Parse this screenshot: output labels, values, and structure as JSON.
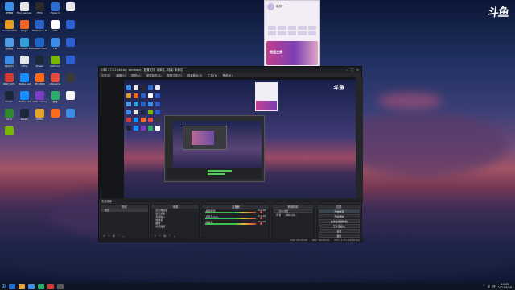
{
  "brand": {
    "logo_text": "斗鱼"
  },
  "desktop": {
    "icons": [
      {
        "label": "此电脑",
        "color": "#3a8ee6"
      },
      {
        "label": "Epic Games Launcher",
        "color": "#e8e8e8"
      },
      {
        "label": "EPIC",
        "color": "#2a2a2a"
      },
      {
        "label": "Hyper-V",
        "color": "#2b6cd4"
      },
      {
        "label": "",
        "color": "#e8e8ee"
      },
      {
        "label": "CounterStrike Global Off",
        "color": "#e59a2a"
      },
      {
        "label": "Origin",
        "color": "#f16522"
      },
      {
        "label": "Wallpaper Engine",
        "color": "#2b62c9"
      },
      {
        "label": "OBS",
        "color": "#ffffff"
      },
      {
        "label": "",
        "color": "#2a5ed1"
      },
      {
        "label": "回收站",
        "color": "#4e9be8"
      },
      {
        "label": "Microsoft Edge",
        "color": "#2fa0d8"
      },
      {
        "label": "Ubisoft Connect",
        "color": "#1e63c7"
      },
      {
        "label": "TIM",
        "color": "#3d8be8"
      },
      {
        "label": "",
        "color": "#2a5ed1"
      },
      {
        "label": "腾讯QQ",
        "color": "#3d8be8"
      },
      {
        "label": "UPlay",
        "color": "#e6e6e6"
      },
      {
        "label": "Steam",
        "color": "#1b2838"
      },
      {
        "label": "GeForce",
        "color": "#76b900"
      },
      {
        "label": "",
        "color": "#2a5ed1"
      },
      {
        "label": "网易云音乐",
        "color": "#d33a31"
      },
      {
        "label": "Battle.net",
        "color": "#148eff"
      },
      {
        "label": "腾讯视频",
        "color": "#ff6a1a"
      },
      {
        "label": "WeGame",
        "color": "#e64a3a"
      },
      {
        "label": "",
        "color": "#3a3a3a"
      },
      {
        "label": "Steam",
        "color": "#1b2838"
      },
      {
        "label": "Battle.net",
        "color": "#148eff"
      },
      {
        "label": "GOG Galaxy",
        "color": "#7a3dc4"
      },
      {
        "label": "微信",
        "color": "#2aae67"
      },
      {
        "label": "",
        "color": "#f5f5f5"
      },
      {
        "label": "Xbox",
        "color": "#2d8a2d"
      },
      {
        "label": "Steam",
        "color": "#1b2838"
      },
      {
        "label": "PUBG",
        "color": "#e4a525"
      },
      {
        "label": "",
        "color": "#ff6a1a"
      },
      {
        "label": "",
        "color": "#3d8be8"
      },
      {
        "label": "",
        "color": "#76b900"
      }
    ]
  },
  "chat_panel": {
    "name": "昵称一",
    "banner_text": "颜值主播"
  },
  "obs": {
    "title": "OBS 27.0.1 (64-bit, windows) - 配置文件: 未命名 - 场景: 未命名",
    "menu": [
      "文件(F)",
      "编辑(E)",
      "视图(V)",
      "停靠部件(D)",
      "配置文件(P)",
      "场景集合(S)",
      "工具(T)",
      "帮助(H)"
    ],
    "source_bar_label": "未选择源",
    "docks": {
      "scenes": {
        "title": "场景",
        "items": [
          "场景"
        ]
      },
      "sources": {
        "title": "来源",
        "items": [
          "显示器采集",
          "窗口采集",
          "音频输入",
          "媒体源",
          "图像",
          "浏览器源"
        ]
      },
      "mixer": {
        "title": "混音器",
        "channels": [
          {
            "label": "桌面音频",
            "value": "0.0 dB"
          },
          {
            "label": "麦克风/Aux",
            "value": "0.0 dB"
          },
          {
            "label": "媒体源",
            "value": "0.0 dB"
          }
        ]
      },
      "transitions": {
        "title": "转场特效",
        "type": "淡入淡出",
        "duration_label": "时长",
        "duration": "300 ms"
      },
      "controls": {
        "title": "控件",
        "buttons": [
          "开始推流",
          "开始录制",
          "启动虚拟摄像机",
          "工作室模式",
          "设置",
          "退出"
        ]
      }
    },
    "status": {
      "live": "LIVE: 00:00:00",
      "rec": "REC: 00:00:00",
      "cpu": "CPU: 1.4%, 60.00 fps"
    }
  },
  "taskbar": {
    "apps": [
      {
        "color": "#1f6fd1"
      },
      {
        "color": "#e8a23a"
      },
      {
        "color": "#3a8ee6"
      },
      {
        "color": "#2aae67"
      },
      {
        "color": "#d33a31"
      },
      {
        "color": "#5a5a5a"
      }
    ],
    "tray_items": [
      "^",
      "中",
      "拼"
    ],
    "time": "13:02",
    "date": "2021/6/28"
  }
}
